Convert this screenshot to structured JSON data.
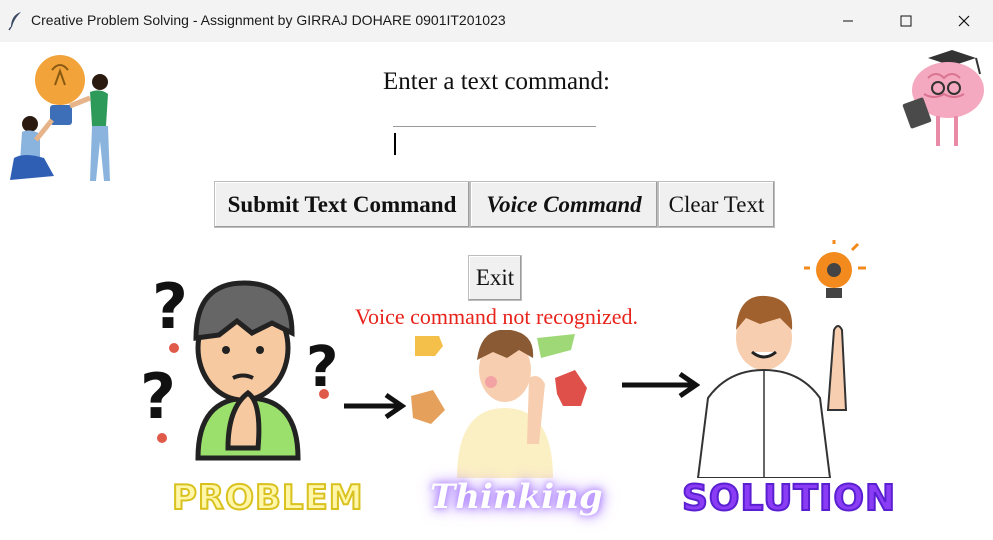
{
  "window": {
    "title": "Creative Problem Solving - Assignment by GIRRAJ DOHARE 0901IT201023",
    "icon": "feather-icon"
  },
  "main": {
    "prompt": "Enter a text command:",
    "input_value": "",
    "buttons": {
      "submit": "Submit Text Command",
      "voice": "Voice Command",
      "clear": "Clear Text",
      "exit": "Exit"
    },
    "status_message": "Voice command not recognized.",
    "status_color": "#e8231c"
  },
  "illustration": {
    "labels": {
      "problem": "PROBLEM",
      "thinking": "Thinking",
      "solution": "SOLUTION"
    }
  }
}
